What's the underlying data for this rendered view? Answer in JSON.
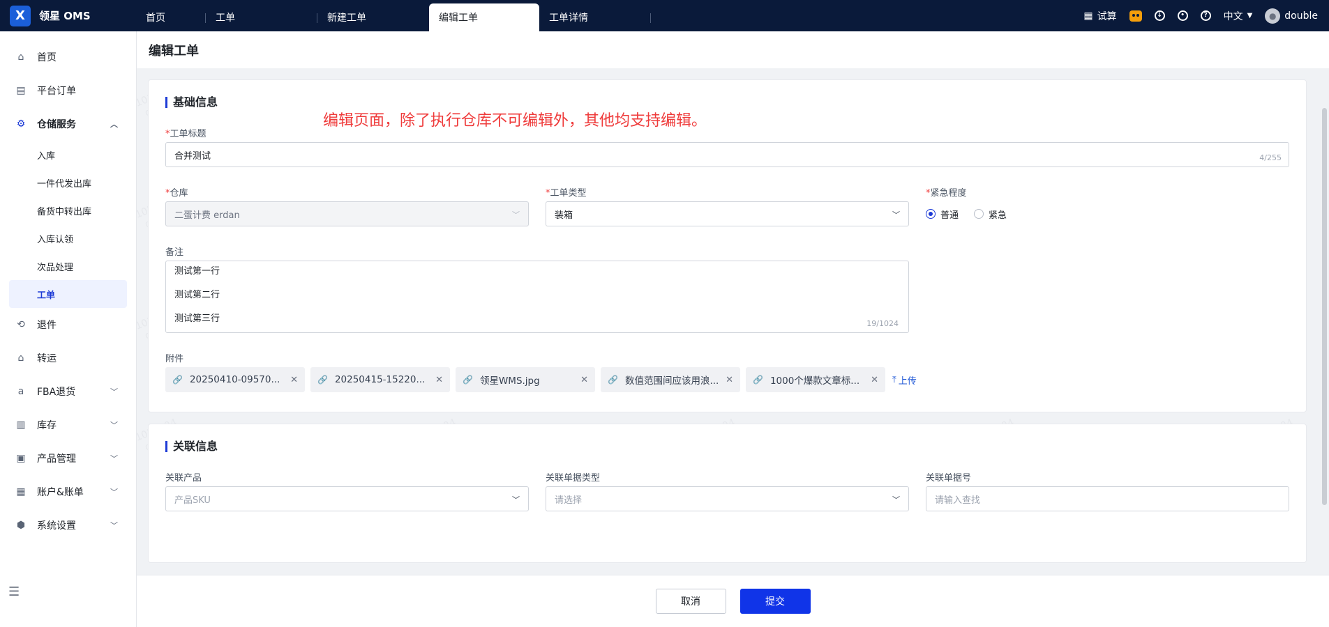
{
  "app": {
    "name": "领星 OMS",
    "logo_letter": "X"
  },
  "tabs": [
    {
      "label": "首页"
    },
    {
      "label": "工单"
    },
    {
      "label": "新建工单"
    },
    {
      "label": "编辑工单",
      "active": true
    },
    {
      "label": "工单详情"
    }
  ],
  "topbar": {
    "calc_label": "试算",
    "lang": "中文",
    "user": "double"
  },
  "sidebar": {
    "items": [
      {
        "label": "首页",
        "icon": "home-icon"
      },
      {
        "label": "平台订单",
        "icon": "clipboard-icon"
      },
      {
        "label": "仓储服务",
        "icon": "warehouse-icon"
      },
      {
        "label": "退件",
        "icon": "return-icon"
      },
      {
        "label": "转运",
        "icon": "transfer-icon"
      },
      {
        "label": "FBA退货",
        "icon": "amazon-icon"
      },
      {
        "label": "库存",
        "icon": "inventory-icon"
      },
      {
        "label": "产品管理",
        "icon": "product-icon"
      },
      {
        "label": "账户&账单",
        "icon": "account-icon"
      },
      {
        "label": "系统设置",
        "icon": "settings-icon"
      }
    ],
    "sub_items": [
      {
        "label": "入库"
      },
      {
        "label": "一件代发出库"
      },
      {
        "label": "备货中转出库"
      },
      {
        "label": "入库认领"
      },
      {
        "label": "次品处理"
      },
      {
        "label": "工单",
        "active": true
      }
    ]
  },
  "page": {
    "title": "编辑工单"
  },
  "basic": {
    "section_title": "基础信息",
    "notice": "编辑页面，除了执行仓库不可编辑外，其他均支持编辑。",
    "title_label": "工单标题",
    "title_value": "合并测试",
    "title_count": "4/255",
    "warehouse_label": "仓库",
    "warehouse_value": "二蛋计费 erdan",
    "type_label": "工单类型",
    "type_value": "装箱",
    "urgency_label": "紧急程度",
    "urgency_options": [
      "普通",
      "紧急"
    ],
    "urgency_selected": "普通",
    "remark_label": "备注",
    "remark_lines": [
      "测试第一行",
      "测试第二行",
      "测试第三行"
    ],
    "remark_count": "19/1024",
    "attach_label": "附件",
    "attachments": [
      "20250410-09570...",
      "20250415-15220...",
      "领星WMS.jpg",
      "数值范围间应该用浪...",
      "1000个爆款文章标..."
    ],
    "upload_label": "上传"
  },
  "related": {
    "section_title": "关联信息",
    "product_label": "关联产品",
    "product_placeholder": "产品SKU",
    "doc_type_label": "关联单据类型",
    "doc_type_placeholder": "请选择",
    "doc_no_label": "关联单据号",
    "doc_no_placeholder": "请输入查找"
  },
  "footer": {
    "cancel": "取消",
    "submit": "提交"
  },
  "watermark": {
    "line1": "1011004",
    "line2": "double"
  }
}
